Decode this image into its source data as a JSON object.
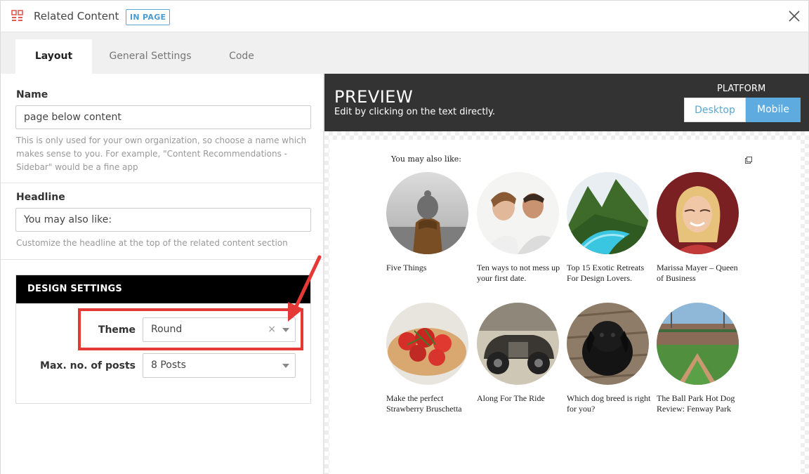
{
  "header": {
    "title": "Related Content",
    "badge": "IN PAGE"
  },
  "tabs": [
    {
      "label": "Layout",
      "active": true
    },
    {
      "label": "General Settings",
      "active": false
    },
    {
      "label": "Code",
      "active": false
    }
  ],
  "form": {
    "name": {
      "label": "Name",
      "value": "page below content",
      "help": "This is only used for your own organization, so choose a name which makes sense to you. For example, \"Content Recommendations - Sidebar\" would be a fine app"
    },
    "headline": {
      "label": "Headline",
      "value": "You may also like:",
      "help": "Customize the headline at the top of the related content section"
    },
    "design": {
      "header": "DESIGN SETTINGS",
      "theme_label": "Theme",
      "theme_value": "Round",
      "clear_symbol": "×",
      "posts_label": "Max. no. of posts",
      "posts_value": "8 Posts"
    }
  },
  "preview": {
    "title": "PREVIEW",
    "subtitle": "Edit by clicking on the text directly.",
    "platform_label": "PLATFORM",
    "desktop_label": "Desktop",
    "mobile_label": "Mobile",
    "selected_platform": "Mobile",
    "headline": "You may also like:",
    "items": [
      {
        "title": "Five Things",
        "image": "person-knit-hat"
      },
      {
        "title": "Ten ways to not mess up your first date.",
        "image": "couple-smiling"
      },
      {
        "title": "Top 15 Exotic Retreats For Design Lovers.",
        "image": "tropical-pool"
      },
      {
        "title": "Marissa Mayer – Queen of Business",
        "image": "woman-portrait"
      },
      {
        "title": "Make the perfect Strawberry Bruschetta",
        "image": "strawberry-bruschetta"
      },
      {
        "title": "Along For The Ride",
        "image": "vintage-car"
      },
      {
        "title": "Which dog breed is right for you?",
        "image": "black-puppy"
      },
      {
        "title": "The Ball Park Hot Dog Review: Fenway Park",
        "image": "ballpark"
      }
    ]
  },
  "colors": {
    "accent": "#5eabe0",
    "highlight": "#e53935",
    "dark": "#333333"
  }
}
